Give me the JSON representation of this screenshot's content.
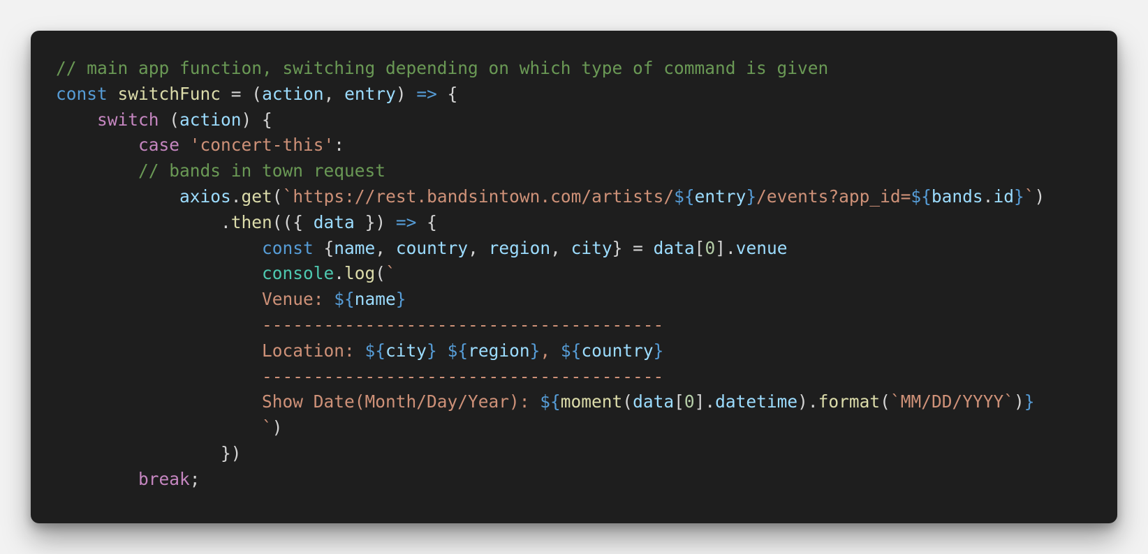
{
  "colors": {
    "background": "#f2f2f2",
    "panel": "#1e1e1e",
    "default": "#d4d4d4",
    "comment": "#6a9955",
    "keyword": "#569cd6",
    "control": "#c586c0",
    "function": "#dcdcaa",
    "variable": "#9cdcfe",
    "string": "#ce9178",
    "number": "#b5cea8",
    "class": "#4ec9b0"
  },
  "code": {
    "lines": [
      {
        "indent": 0,
        "tokens": [
          {
            "t": "// main app function, switching depending on which type of command is given",
            "c": "comment"
          }
        ]
      },
      {
        "indent": 0,
        "tokens": [
          {
            "t": "const",
            "c": "keyword"
          },
          {
            "t": " ",
            "c": "default"
          },
          {
            "t": "switchFunc",
            "c": "function"
          },
          {
            "t": " = (",
            "c": "default"
          },
          {
            "t": "action",
            "c": "variable"
          },
          {
            "t": ", ",
            "c": "default"
          },
          {
            "t": "entry",
            "c": "variable"
          },
          {
            "t": ") ",
            "c": "default"
          },
          {
            "t": "=>",
            "c": "keyword"
          },
          {
            "t": " {",
            "c": "default"
          }
        ]
      },
      {
        "indent": 1,
        "tokens": [
          {
            "t": "switch",
            "c": "control"
          },
          {
            "t": " (",
            "c": "default"
          },
          {
            "t": "action",
            "c": "variable"
          },
          {
            "t": ") {",
            "c": "default"
          }
        ]
      },
      {
        "indent": 2,
        "tokens": [
          {
            "t": "case",
            "c": "control"
          },
          {
            "t": " ",
            "c": "default"
          },
          {
            "t": "'concert-this'",
            "c": "string"
          },
          {
            "t": ":",
            "c": "default"
          }
        ]
      },
      {
        "indent": 2,
        "tokens": [
          {
            "t": "// bands in town request",
            "c": "comment"
          }
        ]
      },
      {
        "indent": 3,
        "tokens": [
          {
            "t": "axios",
            "c": "variable"
          },
          {
            "t": ".",
            "c": "default"
          },
          {
            "t": "get",
            "c": "function"
          },
          {
            "t": "(",
            "c": "default"
          },
          {
            "t": "`https://rest.bandsintown.com/artists/",
            "c": "string"
          },
          {
            "t": "${",
            "c": "keyword"
          },
          {
            "t": "entry",
            "c": "variable"
          },
          {
            "t": "}",
            "c": "keyword"
          },
          {
            "t": "/events?app_id=",
            "c": "string"
          },
          {
            "t": "${",
            "c": "keyword"
          },
          {
            "t": "bands",
            "c": "variable"
          },
          {
            "t": ".",
            "c": "default"
          },
          {
            "t": "id",
            "c": "variable"
          },
          {
            "t": "}",
            "c": "keyword"
          },
          {
            "t": "`",
            "c": "string"
          },
          {
            "t": ")",
            "c": "default"
          }
        ]
      },
      {
        "indent": 4,
        "tokens": [
          {
            "t": ".",
            "c": "default"
          },
          {
            "t": "then",
            "c": "function"
          },
          {
            "t": "(({ ",
            "c": "default"
          },
          {
            "t": "data",
            "c": "variable"
          },
          {
            "t": " }) ",
            "c": "default"
          },
          {
            "t": "=>",
            "c": "keyword"
          },
          {
            "t": " {",
            "c": "default"
          }
        ]
      },
      {
        "indent": 5,
        "tokens": [
          {
            "t": "const",
            "c": "keyword"
          },
          {
            "t": " {",
            "c": "default"
          },
          {
            "t": "name",
            "c": "variable"
          },
          {
            "t": ", ",
            "c": "default"
          },
          {
            "t": "country",
            "c": "variable"
          },
          {
            "t": ", ",
            "c": "default"
          },
          {
            "t": "region",
            "c": "variable"
          },
          {
            "t": ", ",
            "c": "default"
          },
          {
            "t": "city",
            "c": "variable"
          },
          {
            "t": "} = ",
            "c": "default"
          },
          {
            "t": "data",
            "c": "variable"
          },
          {
            "t": "[",
            "c": "default"
          },
          {
            "t": "0",
            "c": "number"
          },
          {
            "t": "].",
            "c": "default"
          },
          {
            "t": "venue",
            "c": "variable"
          }
        ]
      },
      {
        "indent": 5,
        "tokens": [
          {
            "t": "console",
            "c": "class"
          },
          {
            "t": ".",
            "c": "default"
          },
          {
            "t": "log",
            "c": "function"
          },
          {
            "t": "(",
            "c": "default"
          },
          {
            "t": "`",
            "c": "string"
          }
        ]
      },
      {
        "indent": 5,
        "tokens": [
          {
            "t": "Venue: ",
            "c": "string"
          },
          {
            "t": "${",
            "c": "keyword"
          },
          {
            "t": "name",
            "c": "variable"
          },
          {
            "t": "}",
            "c": "keyword"
          }
        ]
      },
      {
        "indent": 5,
        "tokens": [
          {
            "t": "---------------------------------------",
            "c": "string"
          }
        ]
      },
      {
        "indent": 5,
        "tokens": [
          {
            "t": "Location: ",
            "c": "string"
          },
          {
            "t": "${",
            "c": "keyword"
          },
          {
            "t": "city",
            "c": "variable"
          },
          {
            "t": "}",
            "c": "keyword"
          },
          {
            "t": " ",
            "c": "string"
          },
          {
            "t": "${",
            "c": "keyword"
          },
          {
            "t": "region",
            "c": "variable"
          },
          {
            "t": "}",
            "c": "keyword"
          },
          {
            "t": ", ",
            "c": "string"
          },
          {
            "t": "${",
            "c": "keyword"
          },
          {
            "t": "country",
            "c": "variable"
          },
          {
            "t": "}",
            "c": "keyword"
          }
        ]
      },
      {
        "indent": 5,
        "tokens": [
          {
            "t": "---------------------------------------",
            "c": "string"
          }
        ]
      },
      {
        "indent": 5,
        "tokens": [
          {
            "t": "Show Date(Month/Day/Year): ",
            "c": "string"
          },
          {
            "t": "${",
            "c": "keyword"
          },
          {
            "t": "moment",
            "c": "function"
          },
          {
            "t": "(",
            "c": "default"
          },
          {
            "t": "data",
            "c": "variable"
          },
          {
            "t": "[",
            "c": "default"
          },
          {
            "t": "0",
            "c": "number"
          },
          {
            "t": "].",
            "c": "default"
          },
          {
            "t": "datetime",
            "c": "variable"
          },
          {
            "t": ").",
            "c": "default"
          },
          {
            "t": "format",
            "c": "function"
          },
          {
            "t": "(",
            "c": "default"
          },
          {
            "t": "`MM/DD/YYYY`",
            "c": "string"
          },
          {
            "t": ")",
            "c": "default"
          },
          {
            "t": "}",
            "c": "keyword"
          }
        ]
      },
      {
        "indent": 5,
        "tokens": [
          {
            "t": "`",
            "c": "string"
          },
          {
            "t": ")",
            "c": "default"
          }
        ]
      },
      {
        "indent": 4,
        "tokens": [
          {
            "t": "})",
            "c": "default"
          }
        ]
      },
      {
        "indent": 2,
        "tokens": [
          {
            "t": "break",
            "c": "control"
          },
          {
            "t": ";",
            "c": "default"
          }
        ]
      }
    ]
  }
}
